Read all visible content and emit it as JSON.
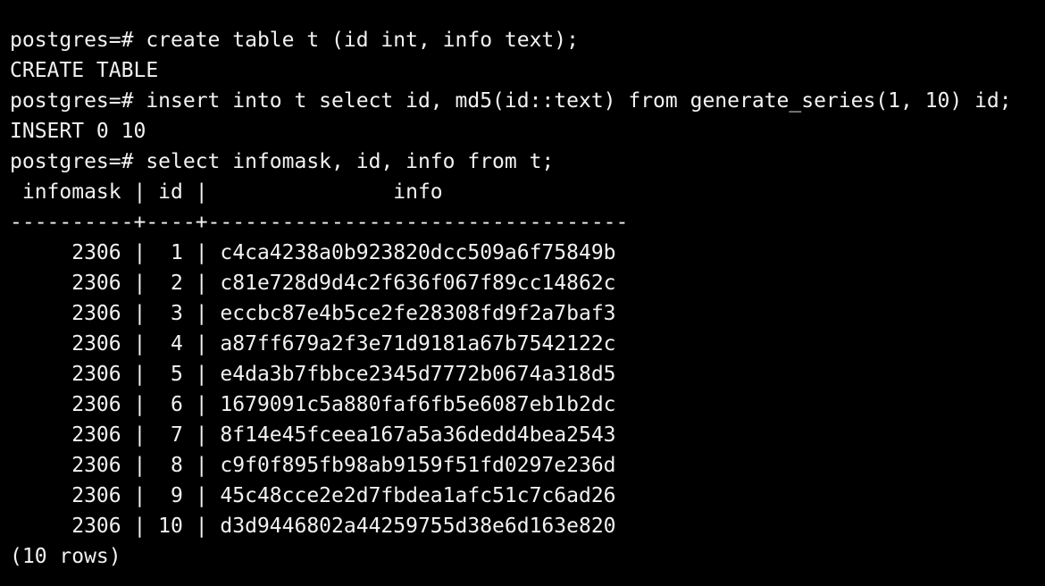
{
  "terminal": {
    "colors": {
      "background": "#000000",
      "foreground": "#f2f2f2"
    },
    "lines": [
      "postgres=# create table t (id int, info text);",
      "CREATE TABLE",
      "postgres=# insert into t select id, md5(id::text) from generate_series(1, 10) id;",
      "INSERT 0 10",
      "postgres=# select infomask, id, info from t;",
      " infomask | id |               info",
      "----------+----+----------------------------------",
      "     2306 |  1 | c4ca4238a0b923820dcc509a6f75849b",
      "     2306 |  2 | c81e728d9d4c2f636f067f89cc14862c",
      "     2306 |  3 | eccbc87e4b5ce2fe28308fd9f2a7baf3",
      "     2306 |  4 | a87ff679a2f3e71d9181a67b7542122c",
      "     2306 |  5 | e4da3b7fbbce2345d7772b0674a318d5",
      "     2306 |  6 | 1679091c5a880faf6fb5e6087eb1b2dc",
      "     2306 |  7 | 8f14e45fceea167a5a36dedd4bea2543",
      "     2306 |  8 | c9f0f895fb98ab9159f51fd0297e236d",
      "     2306 |  9 | 45c48cce2e2d7fbdea1afc51c7c6ad26",
      "     2306 | 10 | d3d9446802a44259755d38e6d163e820",
      "(10 rows)"
    ]
  }
}
